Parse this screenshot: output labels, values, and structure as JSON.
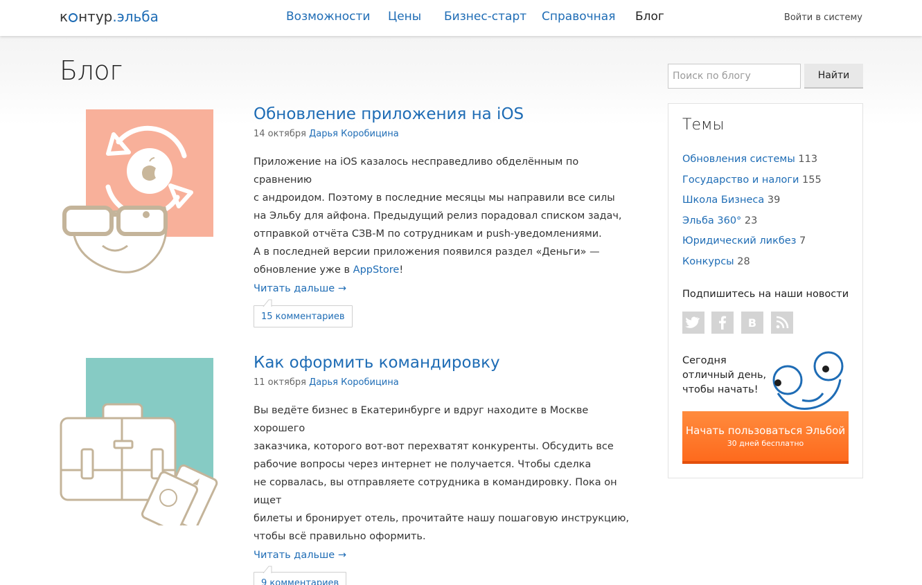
{
  "header": {
    "logo_text_1": "к",
    "logo_text_2": "нтур",
    "logo_text_3": ".эльба",
    "nav": [
      {
        "label": "Возможности",
        "active": false
      },
      {
        "label": "Цены",
        "active": false
      },
      {
        "label": "Бизнес-старт",
        "active": false
      },
      {
        "label": "Справочная",
        "active": false
      },
      {
        "label": "Блог",
        "active": true
      }
    ],
    "login_label": "Войти в систему"
  },
  "page": {
    "title": "Блог",
    "search_placeholder": "Поиск по блогу",
    "search_button": "Найти"
  },
  "posts": [
    {
      "title": "Обновление приложения на iOS",
      "date": "14 октября",
      "author": "Дарья Коробицина",
      "text_before_link": "Приложение на iOS казалось несправедливо обделённым по сравнению\nс андроидом. Поэтому в последние месяцы мы направили все силы\nна Эльбу для айфона. Предыдущий релиз порадовал списком задач,\nотправкой отчёта СЗВ-М по сотрудникам и push-уведомлениями.\nА в последней версии приложения появился раздел «Деньги» —\nобновление уже в ",
      "inline_link": "AppStore",
      "text_after_link": "!",
      "read_more": "Читать дальше →",
      "comments": "15 комментариев",
      "illustration": "ios-update-illustration",
      "accent_color": "#f8b09a"
    },
    {
      "title": "Как оформить командировку",
      "date": "11 октября",
      "author": "Дарья Коробицина",
      "text_before_link": "Вы ведёте бизнес в Екатеринбурге и вдруг находите в Москве хорошего\nзаказчика, которого вот-вот перехватят конкуренты. Обсудить все\nрабочие вопросы через интернет не получается. Чтобы сделка\nне сорвалась, вы отправляете сотрудника в командировку. Пока он ищет\nбилеты и бронирует отель, прочитайте нашу пошаговую инструкцию,\nчтобы всё правильно оформить.",
      "inline_link": "",
      "text_after_link": "",
      "read_more": "Читать дальше →",
      "comments": "9 комментариев",
      "illustration": "business-trip-illustration",
      "accent_color": "#86cbc4"
    }
  ],
  "sidebar": {
    "title": "Темы",
    "topics": [
      {
        "label": "Обновления системы",
        "count": "113"
      },
      {
        "label": "Государство и налоги",
        "count": "155"
      },
      {
        "label": "Школа Бизнеса",
        "count": "39"
      },
      {
        "label": "Эльба 360°",
        "count": "23"
      },
      {
        "label": "Юридический ликбез",
        "count": "7"
      },
      {
        "label": "Конкурсы",
        "count": "28"
      }
    ],
    "subscribe_title": "Подпишитесь на наши новости",
    "social": [
      {
        "name": "twitter-icon",
        "glyph": "t"
      },
      {
        "name": "facebook-icon",
        "glyph": "f"
      },
      {
        "name": "vk-icon",
        "glyph": "В"
      },
      {
        "name": "rss-icon",
        "glyph": ")"
      }
    ],
    "promo_text": "Сегодня\nотличный день,\nчтобы начать!",
    "cta_main": "Начать пользоваться Эльбой",
    "cta_sub": "30 дней бесплатно"
  },
  "colors": {
    "link": "#1e6cb5",
    "cta": "#fe7a2c",
    "illustration_line": "#c4b49a"
  }
}
